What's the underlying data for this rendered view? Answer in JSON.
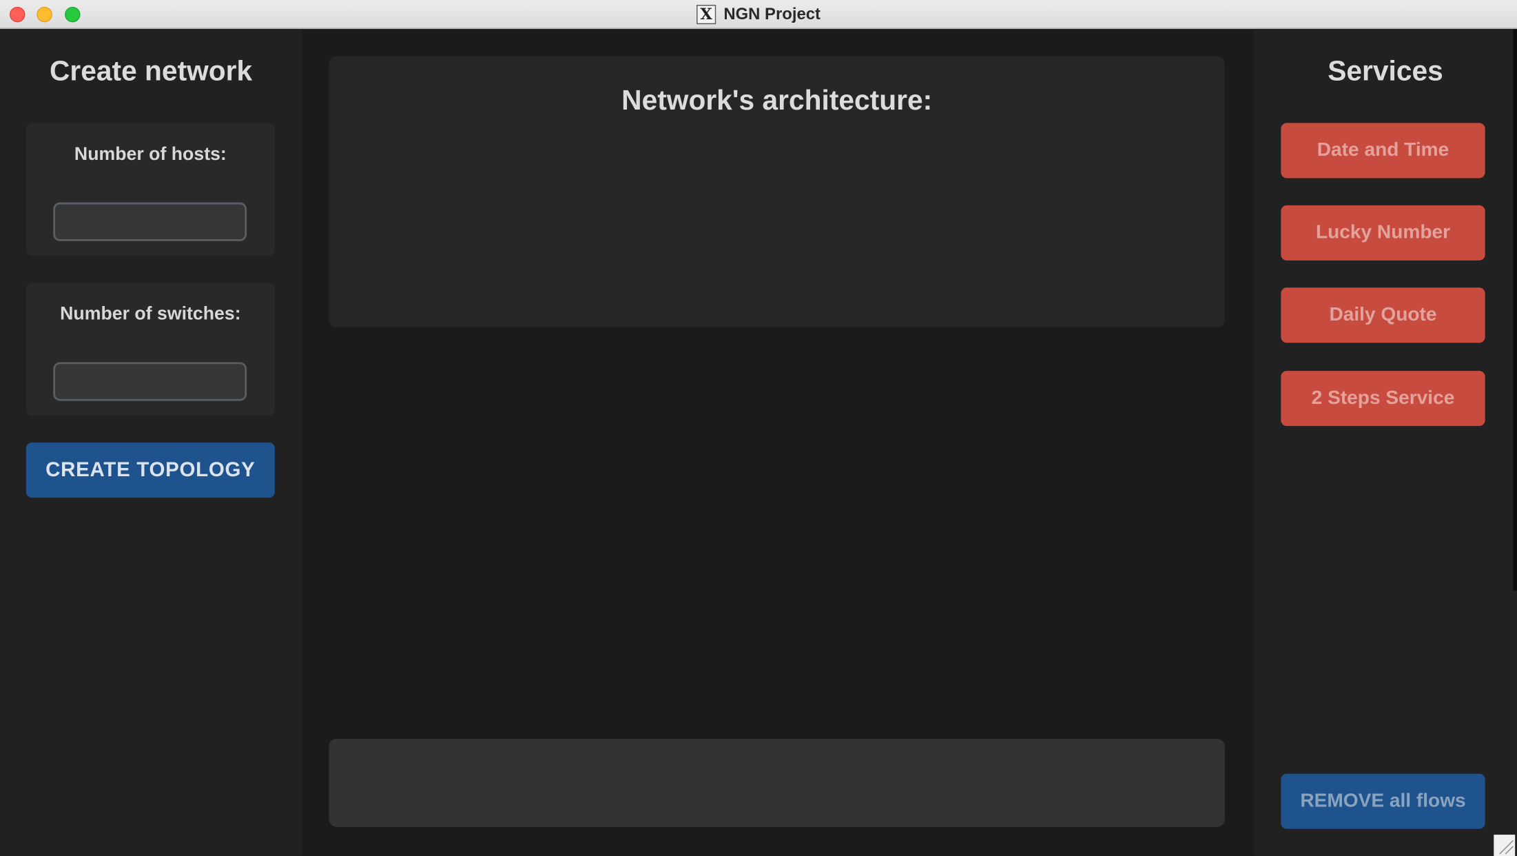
{
  "window": {
    "title": "NGN Project",
    "app_icon": "x11-icon",
    "app_icon_glyph": "X"
  },
  "left_panel": {
    "title": "Create network",
    "hosts": {
      "label": "Number of hosts:",
      "value": ""
    },
    "switches": {
      "label": "Number of switches:",
      "value": ""
    },
    "create_button": "CREATE TOPOLOGY"
  },
  "main": {
    "architecture_title": "Network's architecture:",
    "output_text": ""
  },
  "right_panel": {
    "title": "Services",
    "services": [
      {
        "label": "Date and Time",
        "enabled": false
      },
      {
        "label": "Lucky Number",
        "enabled": false
      },
      {
        "label": "Daily Quote",
        "enabled": false
      },
      {
        "label": "2 Steps Service",
        "enabled": false
      }
    ],
    "remove_button": "REMOVE all flows"
  },
  "colors": {
    "accent_blue": "#1f538d",
    "service_red": "#c84b3f",
    "background": "#1b1b1b",
    "panel": "#212121"
  }
}
